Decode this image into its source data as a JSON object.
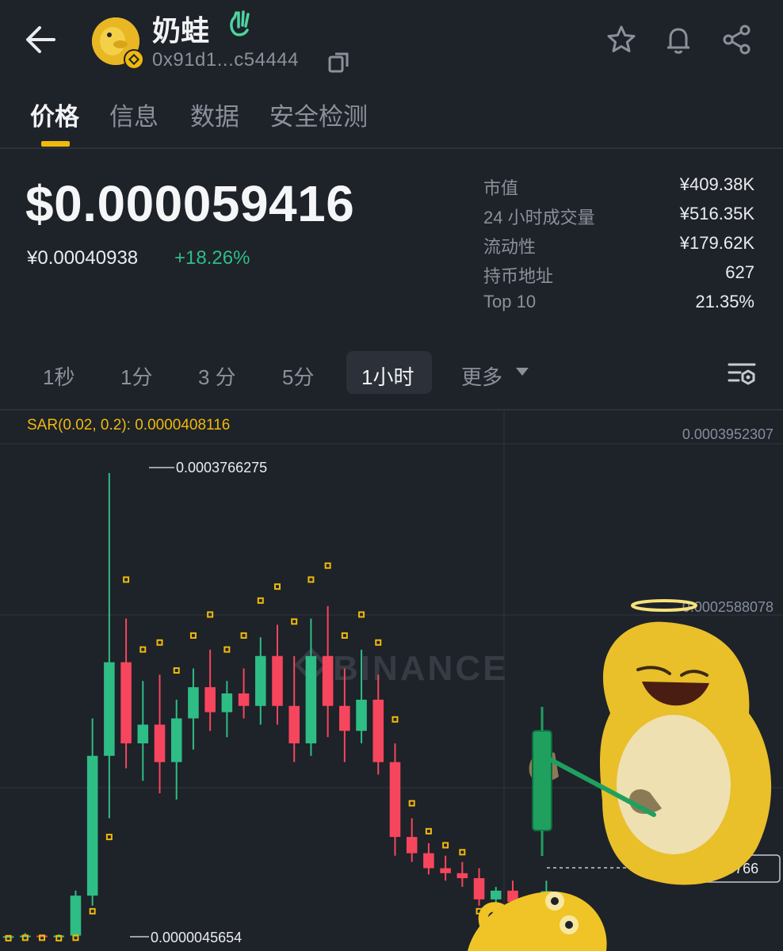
{
  "header": {
    "token_name": "奶蛙",
    "address": "0x91d1...c54444",
    "icons": [
      "back-arrow-icon",
      "bnb-chain-badge-icon",
      "wave-hand-icon",
      "copy-icon",
      "star-icon",
      "bell-icon",
      "share-icon"
    ]
  },
  "tabs": [
    {
      "label": "价格",
      "active": true
    },
    {
      "label": "信息",
      "active": false
    },
    {
      "label": "数据",
      "active": false
    },
    {
      "label": "安全检测",
      "active": false
    }
  ],
  "price": {
    "usd": "$0.000059416",
    "cny": "¥0.00040938",
    "change": "+18.26%"
  },
  "stats": [
    {
      "label": "市值",
      "value": "¥409.38K"
    },
    {
      "label": "24 小时成交量",
      "value": "¥516.35K"
    },
    {
      "label": "流动性",
      "value": "¥179.62K"
    },
    {
      "label": "持币地址",
      "value": "627"
    },
    {
      "label": "Top 10",
      "value": "21.35%"
    }
  ],
  "timeframes": [
    {
      "label": "1秒",
      "active": false
    },
    {
      "label": "1分",
      "active": false
    },
    {
      "label": "3 分",
      "active": false
    },
    {
      "label": "5分",
      "active": false
    },
    {
      "label": "1小时",
      "active": true
    },
    {
      "label": "更多",
      "active": false
    }
  ],
  "chart": {
    "indicator": "SAR(0.02, 0.2): 0.0000408116",
    "axis_top": "0.0003952307",
    "axis_mid": "0.0002588078",
    "current_price_tag": "0.0000415766",
    "max_label": "0.0003766275",
    "min_label": "0.0000045654",
    "watermark": "BINANCE"
  },
  "colors": {
    "background": "#1e2229",
    "up": "#2ebd85",
    "down": "#f6465d",
    "accent": "#f0b90b"
  },
  "chart_data": {
    "type": "candlestick",
    "title": "",
    "interval": "1小时",
    "y_unit": "USD",
    "ylim": [
      0.0,
      0.0004
    ],
    "max_price": 0.0003766275,
    "min_price": 4.5654e-06,
    "current_price": 4.15766e-05,
    "indicator": {
      "name": "SAR",
      "params": [
        0.02,
        0.2
      ],
      "value": 4.08116e-05
    },
    "candles": [
      {
        "o": 5e-06,
        "h": 6e-06,
        "l": 4.6e-06,
        "c": 5.5e-06
      },
      {
        "o": 5.5e-06,
        "h": 8e-06,
        "l": 5e-06,
        "c": 6e-06
      },
      {
        "o": 6e-06,
        "h": 6.5e-06,
        "l": 5e-06,
        "c": 5.2e-06
      },
      {
        "o": 5.2e-06,
        "h": 7e-06,
        "l": 4.6e-06,
        "c": 6e-06
      },
      {
        "o": 6e-06,
        "h": 4.2e-05,
        "l": 5e-06,
        "c": 3.8e-05
      },
      {
        "o": 3.8e-05,
        "h": 0.00018,
        "l": 3e-05,
        "c": 0.00015
      },
      {
        "o": 0.00015,
        "h": 0.0003766,
        "l": 0.0001,
        "c": 0.000225
      },
      {
        "o": 0.000225,
        "h": 0.00026,
        "l": 0.00014,
        "c": 0.00016
      },
      {
        "o": 0.00016,
        "h": 0.00021,
        "l": 0.00013,
        "c": 0.000175
      },
      {
        "o": 0.000175,
        "h": 0.000215,
        "l": 0.00012,
        "c": 0.000145
      },
      {
        "o": 0.000145,
        "h": 0.000195,
        "l": 0.000115,
        "c": 0.00018
      },
      {
        "o": 0.00018,
        "h": 0.00022,
        "l": 0.000155,
        "c": 0.000205
      },
      {
        "o": 0.000205,
        "h": 0.000235,
        "l": 0.00017,
        "c": 0.000185
      },
      {
        "o": 0.000185,
        "h": 0.00021,
        "l": 0.000165,
        "c": 0.0002
      },
      {
        "o": 0.0002,
        "h": 0.00022,
        "l": 0.00018,
        "c": 0.00019
      },
      {
        "o": 0.00019,
        "h": 0.000245,
        "l": 0.000175,
        "c": 0.00023
      },
      {
        "o": 0.00023,
        "h": 0.000255,
        "l": 0.000175,
        "c": 0.00019
      },
      {
        "o": 0.00019,
        "h": 0.00023,
        "l": 0.000145,
        "c": 0.00016
      },
      {
        "o": 0.00016,
        "h": 0.00026,
        "l": 0.00015,
        "c": 0.00023
      },
      {
        "o": 0.00023,
        "h": 0.00027,
        "l": 0.000165,
        "c": 0.00019
      },
      {
        "o": 0.00019,
        "h": 0.00022,
        "l": 0.000145,
        "c": 0.00017
      },
      {
        "o": 0.00017,
        "h": 0.000235,
        "l": 0.00016,
        "c": 0.000195
      },
      {
        "o": 0.000195,
        "h": 0.000215,
        "l": 0.000135,
        "c": 0.000145
      },
      {
        "o": 0.000145,
        "h": 0.00016,
        "l": 7e-05,
        "c": 8.5e-05
      },
      {
        "o": 8.5e-05,
        "h": 0.0001,
        "l": 6.5e-05,
        "c": 7.2e-05
      },
      {
        "o": 7.2e-05,
        "h": 8e-05,
        "l": 5.5e-05,
        "c": 6e-05
      },
      {
        "o": 6e-05,
        "h": 7e-05,
        "l": 5e-05,
        "c": 5.6e-05
      },
      {
        "o": 5.6e-05,
        "h": 6.5e-05,
        "l": 4.5e-05,
        "c": 5.2e-05
      },
      {
        "o": 5.2e-05,
        "h": 6e-05,
        "l": 3e-05,
        "c": 3.5e-05
      },
      {
        "o": 3.5e-05,
        "h": 4.5e-05,
        "l": 2.8e-05,
        "c": 4.2e-05
      },
      {
        "o": 4.2e-05,
        "h": 5e-05,
        "l": 3e-05,
        "c": 3.3e-05
      },
      {
        "o": 3.3e-05,
        "h": 3.8e-05,
        "l": 3e-05,
        "c": 3.6e-05
      },
      {
        "o": 3.6e-05,
        "h": 5e-05,
        "l": 3.5e-05,
        "c": 4.16e-05
      }
    ]
  }
}
